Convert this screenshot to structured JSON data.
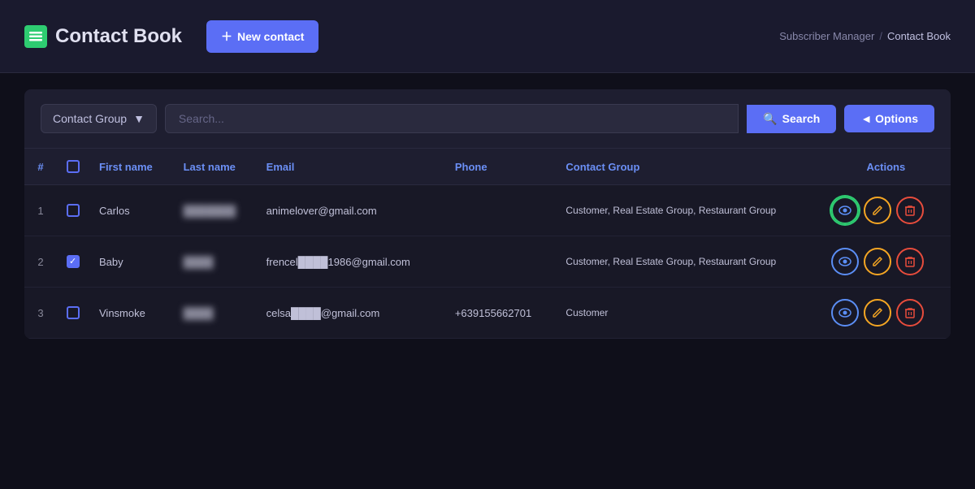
{
  "header": {
    "logo_char": "≡",
    "title": "Contact Book",
    "new_contact_label": "New contact",
    "breadcrumb": {
      "parent": "Subscriber Manager",
      "separator": "/",
      "current": "Contact Book"
    }
  },
  "toolbar": {
    "contact_group_label": "Contact Group",
    "search_placeholder": "Search...",
    "search_btn_label": "Search",
    "options_btn_label": "◄ Options"
  },
  "table": {
    "columns": {
      "hash": "#",
      "first_name": "First name",
      "last_name": "Last name",
      "email": "Email",
      "phone": "Phone",
      "contact_group": "Contact Group",
      "actions": "Actions"
    },
    "rows": [
      {
        "num": "1",
        "checked": false,
        "first_name": "Carlos",
        "last_name": "███████",
        "email": "animelover@gmail.com",
        "phone": "",
        "contact_group": "Customer, Real Estate Group, Restaurant Group",
        "highlight_view": true
      },
      {
        "num": "2",
        "checked": true,
        "first_name": "Baby",
        "last_name": "████",
        "email": "frencel████1986@gmail.com",
        "phone": "",
        "contact_group": "Customer, Real Estate Group, Restaurant Group",
        "highlight_view": false
      },
      {
        "num": "3",
        "checked": false,
        "first_name": "Vinsmoke",
        "last_name": "████",
        "email": "celsa████@gmail.com",
        "phone": "+639155662701",
        "contact_group": "Customer",
        "highlight_view": false
      }
    ]
  }
}
